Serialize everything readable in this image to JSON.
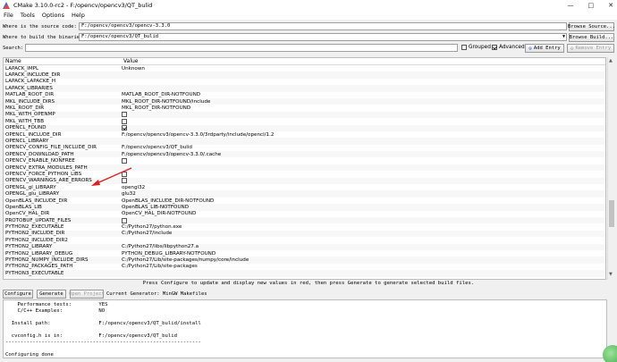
{
  "window": {
    "title": "CMake 3.10.0-rc2 - F:/opencv/opencv3/QT_bulid"
  },
  "menu": [
    "File",
    "Tools",
    "Options",
    "Help"
  ],
  "source": {
    "label": "Where is the source code:",
    "value": "F:/opencv/opencv3/opencv-3.3.0",
    "browse_label": "Browse Source..."
  },
  "build": {
    "label": "Where to build the binaries:",
    "value": "F:/opencv/opencv3/QT_bulid",
    "browse_label": "Browse Build..."
  },
  "search": {
    "label": "Search:",
    "value": "",
    "grouped_label": "Grouped",
    "grouped_checked": false,
    "advanced_label": "Advanced",
    "advanced_checked": true,
    "add_label": "Add Entry",
    "remove_label": "Remove Entry"
  },
  "table": {
    "headers": {
      "name": "Name",
      "value": "Value"
    },
    "rows": [
      {
        "name": "LAPACK_IMPL",
        "value": "Unknown"
      },
      {
        "name": "LAPACK_INCLUDE_DIR",
        "value": ""
      },
      {
        "name": "LAPACK_LAPACKE_H",
        "value": ""
      },
      {
        "name": "LAPACK_LIBRARIES",
        "value": ""
      },
      {
        "name": "MATLAB_ROOT_DIR",
        "value": "MATLAB_ROOT_DIR-NOTFOUND"
      },
      {
        "name": "MKL_INCLUDE_DIRS",
        "value": "MKL_ROOT_DIR-NOTFOUND/include"
      },
      {
        "name": "MKL_ROOT_DIR",
        "value": "MKL_ROOT_DIR-NOTFOUND"
      },
      {
        "name": "MKL_WITH_OPENMP",
        "checkbox": true,
        "checked": false
      },
      {
        "name": "MKL_WITH_TBB",
        "checkbox": true,
        "checked": false
      },
      {
        "name": "OPENCL_FOUND",
        "checkbox": true,
        "checked": true
      },
      {
        "name": "OPENCL_INCLUDE_DIR",
        "value": "F:/opencv/opencv3/opencv-3.3.0/3rdparty/include/opencl/1.2"
      },
      {
        "name": "OPENCL_LIBRARY",
        "value": ""
      },
      {
        "name": "OPENCV_CONFIG_FILE_INCLUDE_DIR",
        "value": "F:/opencv/opencv3/QT_bulid"
      },
      {
        "name": "OPENCV_DOWNLOAD_PATH",
        "value": "F:/opencv/opencv3/opencv-3.3.0/.cache"
      },
      {
        "name": "OPENCV_ENABLE_NONFREE",
        "checkbox": true,
        "checked": false
      },
      {
        "name": "OPENCV_EXTRA_MODULES_PATH",
        "value": ""
      },
      {
        "name": "OPENCV_FORCE_PYTHON_LIBS",
        "checkbox": true,
        "checked": false
      },
      {
        "name": "OPENCV_WARNINGS_ARE_ERRORS",
        "checkbox": true,
        "checked": false
      },
      {
        "name": "OPENGL_gl_LIBRARY",
        "value": "opengl32"
      },
      {
        "name": "OPENGL_glu_LIBRARY",
        "value": "glu32"
      },
      {
        "name": "OpenBLAS_INCLUDE_DIR",
        "value": "OpenBLAS_INCLUDE_DIR-NOTFOUND"
      },
      {
        "name": "OpenBLAS_LIB",
        "value": "OpenBLAS_LIB-NOTFOUND"
      },
      {
        "name": "OpenCV_HAL_DIR",
        "value": "OpenCV_HAL_DIR-NOTFOUND"
      },
      {
        "name": "PROTOBUF_UPDATE_FILES",
        "checkbox": true,
        "checked": false
      },
      {
        "name": "PYTHON2_EXECUTABLE",
        "value": "C:/Python27/python.exe"
      },
      {
        "name": "PYTHON2_INCLUDE_DIR",
        "value": "C:/Python27/include"
      },
      {
        "name": "PYTHON2_INCLUDE_DIR2",
        "value": ""
      },
      {
        "name": "PYTHON2_LIBRARY",
        "value": "C:/Python27/libs/libpython27.a"
      },
      {
        "name": "PYTHON2_LIBRARY_DEBUG",
        "value": "PYTHON_DEBUG_LIBRARY-NOTFOUND"
      },
      {
        "name": "PYTHON2_NUMPY_INCLUDE_DIRS",
        "value": "C:/Python27/Lib/site-packages/numpy/core/include"
      },
      {
        "name": "PYTHON2_PACKAGES_PATH",
        "value": "C:/Python27/Lib/site-packages"
      },
      {
        "name": "PYTHON3_EXECUTABLE",
        "value": ""
      }
    ]
  },
  "status_message": "Press Configure to update and display new values in red, then press Generate to generate selected build files.",
  "actions": {
    "configure": "Configure",
    "generate": "Generate",
    "open_project": "Open Project",
    "generator": "Current Generator: MinGW Makefiles"
  },
  "output": {
    "lines": [
      "    Performance tests:         YES",
      "    C/C++ Examples:            NO",
      "",
      "  Install path:                F:/opencv/opencv3/QT_bulid/install",
      "",
      "  cvconfig.h is in:            F:/opencv/opencv3/QT_bulid",
      "-----------------------------------------------------------------",
      "",
      "Configuring done"
    ]
  },
  "colors": {
    "accent": "#3a6fd8",
    "annotation_arrow": "#e02020"
  }
}
